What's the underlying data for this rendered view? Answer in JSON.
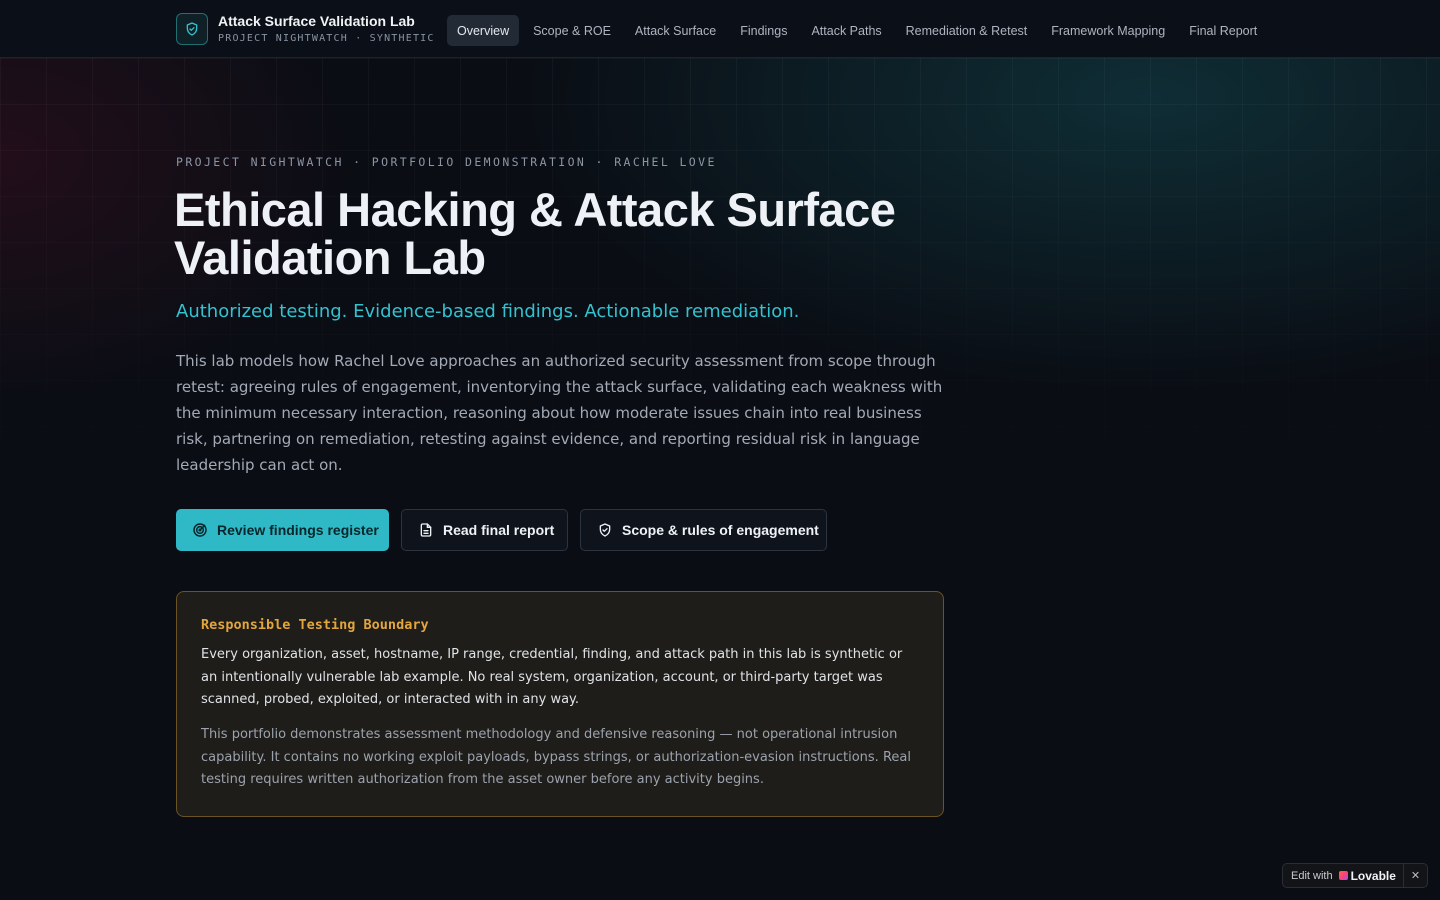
{
  "brand": {
    "title": "Attack Surface Validation Lab",
    "subtitle": "PROJECT NIGHTWATCH · SYNTHETIC",
    "icon": "shield-icon"
  },
  "nav": {
    "items": [
      {
        "label": "Overview",
        "active": true
      },
      {
        "label": "Scope & ROE",
        "active": false
      },
      {
        "label": "Attack Surface",
        "active": false
      },
      {
        "label": "Findings",
        "active": false
      },
      {
        "label": "Attack Paths",
        "active": false
      },
      {
        "label": "Remediation & Retest",
        "active": false
      },
      {
        "label": "Framework Mapping",
        "active": false
      },
      {
        "label": "Final Report",
        "active": false
      }
    ]
  },
  "hero": {
    "eyebrow": "PROJECT NIGHTWATCH · PORTFOLIO DEMONSTRATION · RACHEL LOVE",
    "title": "Ethical Hacking & Attack Surface Validation Lab",
    "tagline": "Authorized testing. Evidence-based findings. Actionable remediation.",
    "intro": "This lab models how Rachel Love approaches an authorized security assessment from scope through retest: agreeing rules of engagement, inventorying the attack surface, validating each weakness with the minimum necessary interaction, reasoning about how moderate issues chain into real business risk, partnering on remediation, retesting against evidence, and reporting residual risk in language leadership can act on."
  },
  "actions": {
    "findings_label": "Review findings register",
    "findings_icon": "radar-icon",
    "report_label": "Read final report",
    "report_icon": "document-icon",
    "scope_label": "Scope & rules of engagement",
    "scope_icon": "shield-icon"
  },
  "notice": {
    "title": "Responsible Testing Boundary",
    "p1": "Every organization, asset, hostname, IP range, credential, finding, and attack path in this lab is synthetic or an intentionally vulnerable lab example. No real system, organization, account, or third-party target was scanned, probed, exploited, or interacted with in any way.",
    "p2": "This portfolio demonstrates assessment methodology and defensive reasoning — not operational intrusion capability. It contains no working exploit payloads, bypass strings, or authorization-evasion instructions. Real testing requires written authorization from the asset owner before any activity begins."
  },
  "lovable": {
    "edit_label": "Edit with",
    "brand": "Lovable",
    "close": "✕"
  },
  "colors": {
    "accent": "#2fb9c6",
    "warning": "#e3a63d",
    "background": "#0a0d14"
  }
}
